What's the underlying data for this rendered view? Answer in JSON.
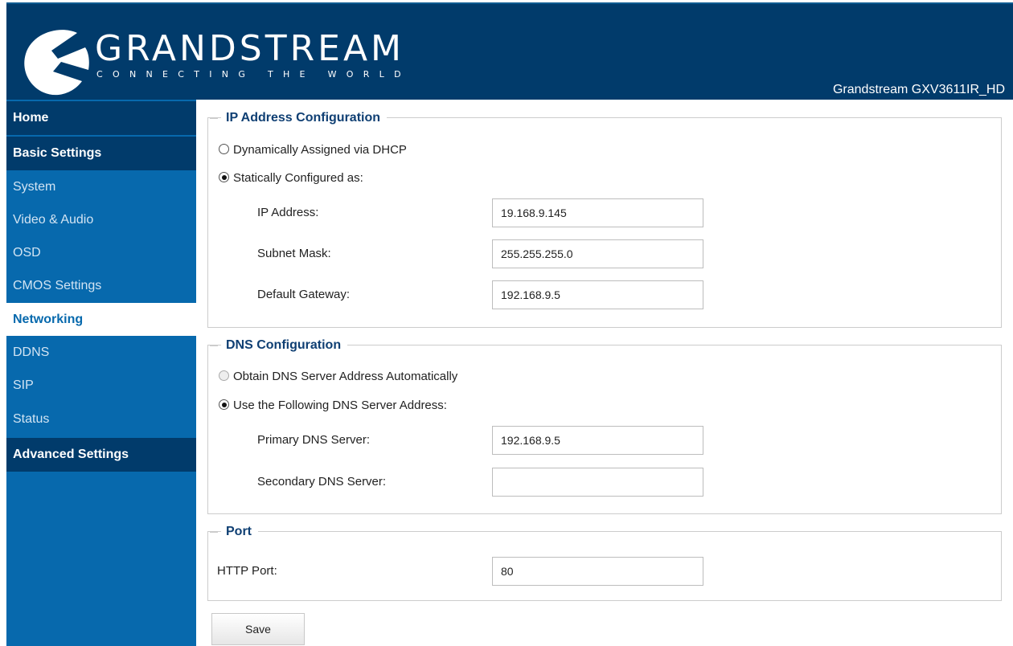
{
  "header": {
    "brand": "GRANDSTREAM",
    "tagline": "CONNECTING THE WORLD",
    "model": "Grandstream GXV3611IR_HD"
  },
  "sidebar": {
    "items": [
      {
        "label": "Home",
        "type": "header"
      },
      {
        "label": "Basic Settings",
        "type": "header"
      },
      {
        "label": "System",
        "type": "sub"
      },
      {
        "label": "Video & Audio",
        "type": "sub"
      },
      {
        "label": "OSD",
        "type": "sub"
      },
      {
        "label": "CMOS Settings",
        "type": "sub"
      },
      {
        "label": "Networking",
        "type": "active"
      },
      {
        "label": "DDNS",
        "type": "sub"
      },
      {
        "label": "SIP",
        "type": "sub"
      },
      {
        "label": "Status",
        "type": "sub"
      },
      {
        "label": "Advanced Settings",
        "type": "header"
      }
    ]
  },
  "ip_config": {
    "legend": "IP Address Configuration",
    "option_dhcp": "Dynamically Assigned via DHCP",
    "option_static": "Statically Configured as:",
    "selected": "static",
    "ip_label": "IP Address:",
    "ip_value": "19.168.9.145",
    "mask_label": "Subnet Mask:",
    "mask_value": "255.255.255.0",
    "gateway_label": "Default Gateway:",
    "gateway_value": "192.168.9.5"
  },
  "dns_config": {
    "legend": "DNS Configuration",
    "option_auto": "Obtain DNS Server Address Automatically",
    "option_manual": "Use the Following DNS Server Address:",
    "selected": "manual",
    "primary_label": "Primary DNS Server:",
    "primary_value": "192.168.9.5",
    "secondary_label": "Secondary DNS Server:",
    "secondary_value": ""
  },
  "port": {
    "legend": "Port",
    "http_label": "HTTP Port:",
    "http_value": "80"
  },
  "actions": {
    "save_label": "Save"
  },
  "colors": {
    "header_bg": "#013b6b",
    "sidebar_bg": "#0769ad",
    "legend_text": "#0f3f73"
  }
}
